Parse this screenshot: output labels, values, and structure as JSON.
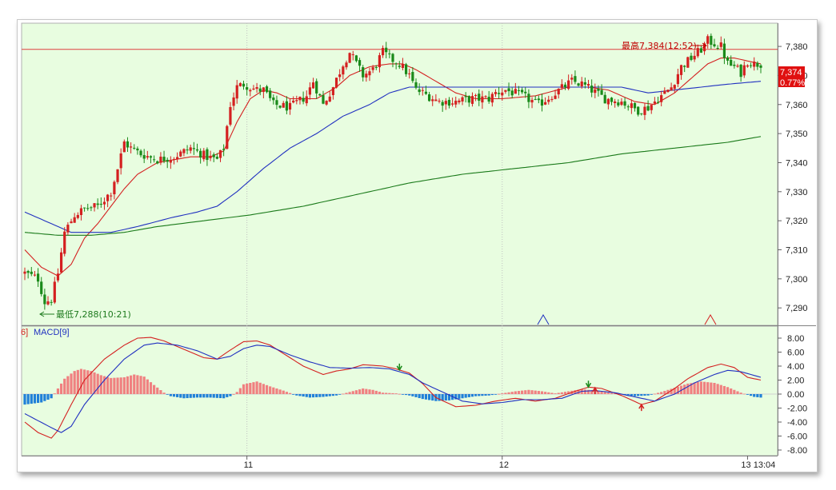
{
  "chart_data": [
    {
      "type": "candlestick",
      "title": "",
      "ylim": [
        7284,
        7388
      ],
      "y_ticks": [
        "7,380",
        "7,370",
        "7,360",
        "7,350",
        "7,340",
        "7,330",
        "7,320",
        "7,310",
        "7,300",
        "7,290"
      ],
      "y_tick_values": [
        7380,
        7370,
        7360,
        7350,
        7340,
        7330,
        7320,
        7310,
        7300,
        7290
      ],
      "x_ticks": [
        "11",
        "12",
        "13 13:04"
      ],
      "x_tick_index": [
        67,
        144,
        218
      ],
      "n_bars": 223,
      "high_label": "最高7,384(12:52)",
      "high_value": 7384,
      "low_label": "最低7,288(10:21)",
      "low_value": 7288,
      "reference_line": 7379,
      "last_price": "7,374",
      "last_change": "0.77%",
      "background": "#e8fde0",
      "up_color": "#d42020",
      "down_color": "#1a8a1a",
      "anchors": [
        [
          0,
          7302
        ],
        [
          4,
          7300
        ],
        [
          6,
          7292
        ],
        [
          8,
          7293
        ],
        [
          10,
          7302
        ],
        [
          12,
          7316
        ],
        [
          15,
          7322
        ],
        [
          18,
          7324
        ],
        [
          22,
          7325
        ],
        [
          26,
          7330
        ],
        [
          28,
          7338
        ],
        [
          30,
          7347
        ],
        [
          32,
          7345
        ],
        [
          35,
          7343
        ],
        [
          40,
          7341
        ],
        [
          45,
          7342
        ],
        [
          50,
          7345
        ],
        [
          55,
          7342
        ],
        [
          58,
          7341
        ],
        [
          60,
          7345
        ],
        [
          62,
          7360
        ],
        [
          64,
          7366
        ],
        [
          66,
          7367
        ],
        [
          70,
          7365
        ],
        [
          72,
          7365
        ],
        [
          75,
          7360
        ],
        [
          80,
          7359
        ],
        [
          85,
          7363
        ],
        [
          87,
          7368
        ],
        [
          90,
          7360
        ],
        [
          93,
          7366
        ],
        [
          96,
          7374
        ],
        [
          98,
          7378
        ],
        [
          100,
          7374
        ],
        [
          102,
          7370
        ],
        [
          105,
          7372
        ],
        [
          108,
          7378
        ],
        [
          110,
          7376
        ],
        [
          113,
          7374
        ],
        [
          116,
          7370
        ],
        [
          118,
          7365
        ],
        [
          120,
          7364
        ],
        [
          125,
          7361
        ],
        [
          130,
          7361
        ],
        [
          135,
          7362
        ],
        [
          140,
          7362
        ],
        [
          142,
          7364
        ],
        [
          145,
          7365
        ],
        [
          150,
          7363
        ],
        [
          155,
          7360
        ],
        [
          160,
          7364
        ],
        [
          165,
          7368
        ],
        [
          168,
          7367
        ],
        [
          171,
          7365
        ],
        [
          175,
          7362
        ],
        [
          180,
          7361
        ],
        [
          185,
          7358
        ],
        [
          188,
          7359
        ],
        [
          191,
          7362
        ],
        [
          195,
          7366
        ],
        [
          198,
          7373
        ],
        [
          201,
          7376
        ],
        [
          204,
          7379
        ],
        [
          206,
          7382
        ],
        [
          208,
          7381
        ],
        [
          210,
          7380
        ],
        [
          212,
          7374
        ],
        [
          214,
          7373
        ],
        [
          216,
          7371
        ],
        [
          218,
          7375
        ],
        [
          220,
          7374
        ],
        [
          222,
          7374
        ]
      ],
      "ma_lines": [
        {
          "color": "#d42020",
          "points": [
            [
              0,
              7310
            ],
            [
              5,
              7304
            ],
            [
              10,
              7301
            ],
            [
              14,
              7305
            ],
            [
              18,
              7314
            ],
            [
              22,
              7319
            ],
            [
              26,
              7325
            ],
            [
              30,
              7331
            ],
            [
              34,
              7336
            ],
            [
              40,
              7340
            ],
            [
              50,
              7342
            ],
            [
              56,
              7342
            ],
            [
              60,
              7344
            ],
            [
              64,
              7354
            ],
            [
              68,
              7362
            ],
            [
              72,
              7365
            ],
            [
              76,
              7364
            ],
            [
              80,
              7362
            ],
            [
              88,
              7362
            ],
            [
              94,
              7366
            ],
            [
              98,
              7370
            ],
            [
              104,
              7373
            ],
            [
              110,
              7374
            ],
            [
              114,
              7374
            ],
            [
              118,
              7372
            ],
            [
              124,
              7368
            ],
            [
              130,
              7364
            ],
            [
              136,
              7362
            ],
            [
              144,
              7362
            ],
            [
              154,
              7363
            ],
            [
              164,
              7366
            ],
            [
              170,
              7366
            ],
            [
              176,
              7365
            ],
            [
              184,
              7361
            ],
            [
              190,
              7360
            ],
            [
              196,
              7364
            ],
            [
              202,
              7370
            ],
            [
              206,
              7374
            ],
            [
              210,
              7376
            ],
            [
              214,
              7376
            ],
            [
              218,
              7375
            ],
            [
              222,
              7374
            ]
          ]
        },
        {
          "color": "#2030c0",
          "points": [
            [
              0,
              7323
            ],
            [
              8,
              7319
            ],
            [
              14,
              7316
            ],
            [
              20,
              7316
            ],
            [
              26,
              7316
            ],
            [
              34,
              7318
            ],
            [
              44,
              7321
            ],
            [
              52,
              7323
            ],
            [
              58,
              7325
            ],
            [
              64,
              7330
            ],
            [
              72,
              7338
            ],
            [
              80,
              7345
            ],
            [
              88,
              7350
            ],
            [
              96,
              7356
            ],
            [
              104,
              7360
            ],
            [
              110,
              7364
            ],
            [
              116,
              7366
            ],
            [
              124,
              7366
            ],
            [
              134,
              7366
            ],
            [
              144,
              7366
            ],
            [
              154,
              7366
            ],
            [
              162,
              7366
            ],
            [
              170,
              7366
            ],
            [
              180,
              7366
            ],
            [
              188,
              7364
            ],
            [
              196,
              7365
            ],
            [
              204,
              7366
            ],
            [
              212,
              7367
            ],
            [
              222,
              7368
            ]
          ]
        },
        {
          "color": "#1a7a1a",
          "points": [
            [
              0,
              7316
            ],
            [
              10,
              7315
            ],
            [
              20,
              7315
            ],
            [
              30,
              7316
            ],
            [
              40,
              7318
            ],
            [
              54,
              7320
            ],
            [
              68,
              7322
            ],
            [
              84,
              7325
            ],
            [
              100,
              7329
            ],
            [
              116,
              7333
            ],
            [
              132,
              7336
            ],
            [
              148,
              7338
            ],
            [
              164,
              7340
            ],
            [
              180,
              7343
            ],
            [
              196,
              7345
            ],
            [
              212,
              7347
            ],
            [
              222,
              7349
            ]
          ]
        }
      ]
    },
    {
      "type": "bar",
      "title": "",
      "legend": "MACD[9]",
      "legend_prefix": "6]",
      "ylim": [
        -8,
        8
      ],
      "y_ticks": [
        "8.00",
        "6.00",
        "4.00",
        "2.00",
        "0.00",
        "-2.00",
        "-4.00",
        "-6.00",
        "-8.00"
      ],
      "y_tick_values": [
        8,
        6,
        4,
        2,
        0,
        -2,
        -4,
        -6,
        -8
      ],
      "histogram": [
        [
          0,
          -1.5
        ],
        [
          5,
          -1.2
        ],
        [
          8,
          -0.6
        ],
        [
          10,
          0.8
        ],
        [
          12,
          2.2
        ],
        [
          15,
          3.3
        ],
        [
          17,
          3.6
        ],
        [
          20,
          3.3
        ],
        [
          23,
          2.7
        ],
        [
          26,
          2.3
        ],
        [
          30,
          2.4
        ],
        [
          33,
          2.8
        ],
        [
          36,
          2.5
        ],
        [
          39,
          1.3
        ],
        [
          42,
          0.2
        ],
        [
          44,
          -0.3
        ],
        [
          48,
          -0.6
        ],
        [
          52,
          -0.5
        ],
        [
          56,
          -0.5
        ],
        [
          60,
          -0.6
        ],
        [
          62,
          -0.3
        ],
        [
          64,
          0.3
        ],
        [
          66,
          1.4
        ],
        [
          70,
          1.8
        ],
        [
          74,
          1.1
        ],
        [
          78,
          0.5
        ],
        [
          82,
          -0.2
        ],
        [
          86,
          -0.5
        ],
        [
          90,
          -0.4
        ],
        [
          94,
          -0.2
        ],
        [
          98,
          0.3
        ],
        [
          102,
          0.8
        ],
        [
          105,
          0.6
        ],
        [
          108,
          0.2
        ],
        [
          112,
          0.1
        ],
        [
          116,
          -0.2
        ],
        [
          120,
          -0.7
        ],
        [
          124,
          -1.0
        ],
        [
          128,
          -0.9
        ],
        [
          132,
          -0.6
        ],
        [
          136,
          -0.3
        ],
        [
          140,
          -0.2
        ],
        [
          144,
          0.1
        ],
        [
          148,
          0.4
        ],
        [
          152,
          0.6
        ],
        [
          156,
          0.4
        ],
        [
          160,
          0.1
        ],
        [
          164,
          0.4
        ],
        [
          168,
          0.7
        ],
        [
          172,
          0.5
        ],
        [
          176,
          0.2
        ],
        [
          180,
          0.0
        ],
        [
          184,
          -0.3
        ],
        [
          188,
          -0.2
        ],
        [
          192,
          0.3
        ],
        [
          196,
          0.9
        ],
        [
          200,
          1.5
        ],
        [
          204,
          1.8
        ],
        [
          208,
          1.6
        ],
        [
          212,
          1.0
        ],
        [
          216,
          0.2
        ],
        [
          220,
          -0.4
        ],
        [
          222,
          -0.5
        ]
      ],
      "macd_line": {
        "color": "#d42020",
        "points": [
          [
            0,
            -4.0
          ],
          [
            4,
            -5.5
          ],
          [
            8,
            -6.3
          ],
          [
            10,
            -5.2
          ],
          [
            14,
            -1.5
          ],
          [
            18,
            2.0
          ],
          [
            24,
            5.0
          ],
          [
            30,
            7.0
          ],
          [
            34,
            8.0
          ],
          [
            38,
            8.1
          ],
          [
            42,
            7.6
          ],
          [
            46,
            6.8
          ],
          [
            50,
            6.0
          ],
          [
            54,
            5.2
          ],
          [
            58,
            5.0
          ],
          [
            62,
            6.3
          ],
          [
            66,
            7.5
          ],
          [
            70,
            7.6
          ],
          [
            74,
            7.0
          ],
          [
            78,
            5.8
          ],
          [
            84,
            4.0
          ],
          [
            90,
            2.8
          ],
          [
            94,
            3.3
          ],
          [
            98,
            3.6
          ],
          [
            102,
            4.2
          ],
          [
            108,
            4.0
          ],
          [
            112,
            3.6
          ],
          [
            116,
            3.0
          ],
          [
            120,
            1.5
          ],
          [
            124,
            -0.5
          ],
          [
            130,
            -1.8
          ],
          [
            136,
            -1.6
          ],
          [
            142,
            -1.0
          ],
          [
            148,
            -0.6
          ],
          [
            154,
            -1.0
          ],
          [
            160,
            -0.6
          ],
          [
            166,
            0.4
          ],
          [
            170,
            1.0
          ],
          [
            174,
            0.8
          ],
          [
            180,
            -0.2
          ],
          [
            186,
            -1.5
          ],
          [
            190,
            -1.0
          ],
          [
            196,
            0.8
          ],
          [
            200,
            2.2
          ],
          [
            206,
            3.8
          ],
          [
            210,
            4.3
          ],
          [
            214,
            3.8
          ],
          [
            218,
            2.4
          ],
          [
            222,
            2.0
          ]
        ]
      },
      "signal_line": {
        "color": "#2030c0",
        "points": [
          [
            0,
            -2.8
          ],
          [
            4,
            -3.8
          ],
          [
            8,
            -4.8
          ],
          [
            11,
            -5.5
          ],
          [
            14,
            -4.6
          ],
          [
            18,
            -1.5
          ],
          [
            24,
            2.0
          ],
          [
            30,
            5.0
          ],
          [
            36,
            7.0
          ],
          [
            40,
            7.3
          ],
          [
            46,
            7.0
          ],
          [
            52,
            6.2
          ],
          [
            58,
            5.0
          ],
          [
            62,
            5.4
          ],
          [
            66,
            6.5
          ],
          [
            70,
            7.0
          ],
          [
            74,
            6.8
          ],
          [
            80,
            5.6
          ],
          [
            86,
            4.6
          ],
          [
            92,
            3.8
          ],
          [
            98,
            3.7
          ],
          [
            104,
            3.8
          ],
          [
            110,
            3.6
          ],
          [
            116,
            2.8
          ],
          [
            120,
            1.6
          ],
          [
            126,
            0.3
          ],
          [
            132,
            -1.0
          ],
          [
            138,
            -1.4
          ],
          [
            144,
            -1.2
          ],
          [
            150,
            -0.8
          ],
          [
            156,
            -0.8
          ],
          [
            162,
            -0.6
          ],
          [
            168,
            0.4
          ],
          [
            172,
            0.5
          ],
          [
            178,
            0.2
          ],
          [
            184,
            -0.4
          ],
          [
            190,
            -1.0
          ],
          [
            196,
            0.0
          ],
          [
            202,
            1.6
          ],
          [
            208,
            2.8
          ],
          [
            212,
            3.4
          ],
          [
            216,
            3.2
          ],
          [
            222,
            2.4
          ]
        ]
      }
    }
  ]
}
